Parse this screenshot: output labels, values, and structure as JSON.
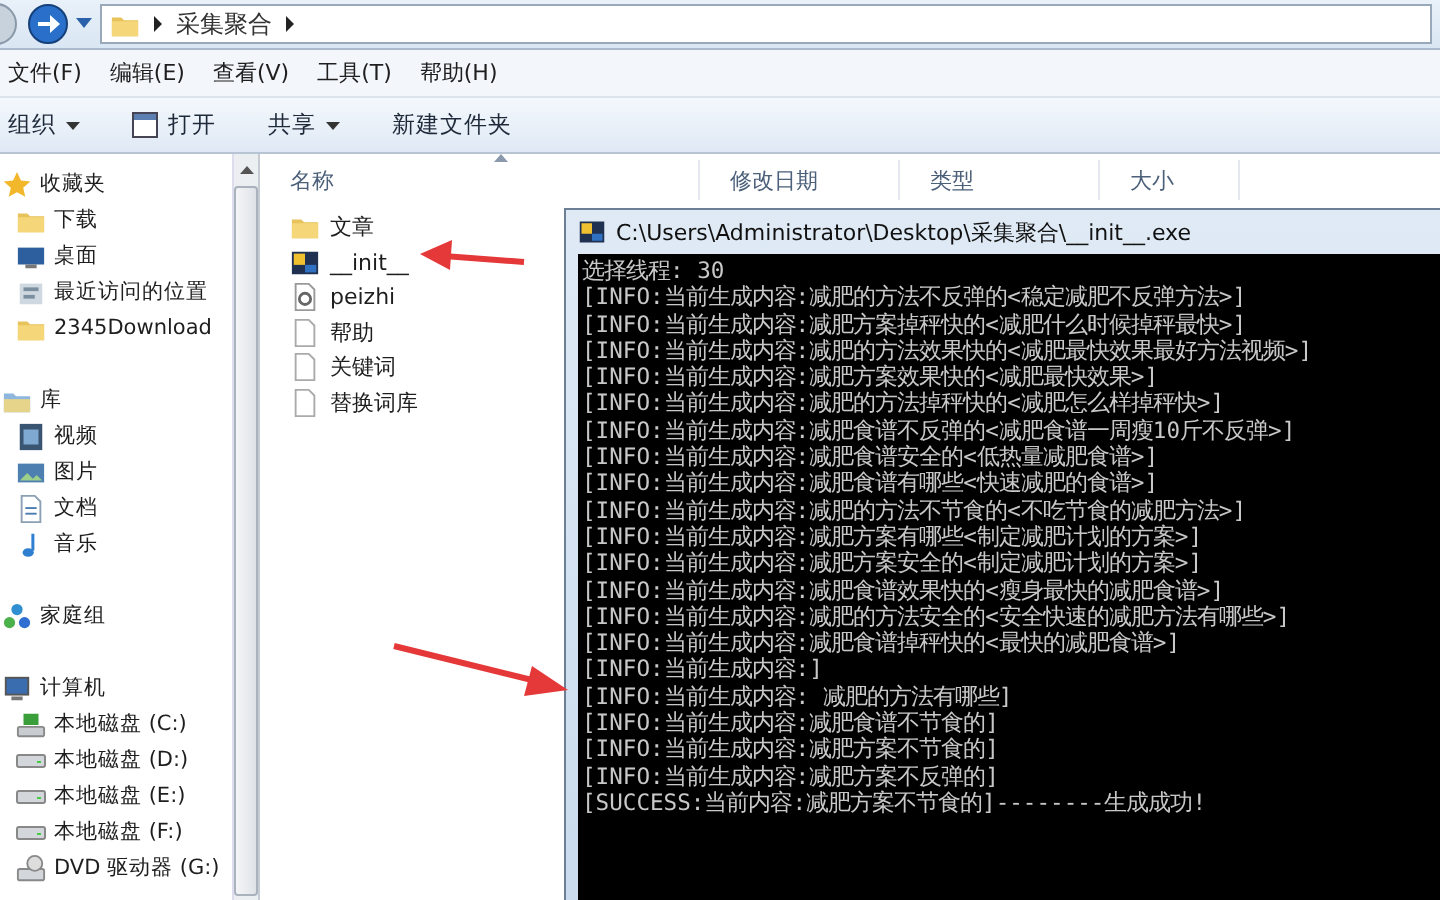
{
  "address_bar": {
    "path": [
      "采集聚合"
    ]
  },
  "menu_bar": [
    "文件(F)",
    "编辑(E)",
    "查看(V)",
    "工具(T)",
    "帮助(H)"
  ],
  "toolbar": [
    {
      "label": "组织",
      "kind": "menu"
    },
    {
      "label": "打开",
      "kind": "open"
    },
    {
      "label": "共享",
      "kind": "menu"
    },
    {
      "label": "新建文件夹",
      "kind": "plain"
    }
  ],
  "sidebar": {
    "groups": [
      {
        "label": "收藏夹",
        "kind": "star",
        "children": [
          {
            "label": "下载",
            "kind": "folder"
          },
          {
            "label": "桌面",
            "kind": "desktop"
          },
          {
            "label": "最近访问的位置",
            "kind": "recent"
          },
          {
            "label": "2345Download",
            "kind": "folder"
          }
        ]
      },
      {
        "label": "库",
        "kind": "library",
        "children": [
          {
            "label": "视频",
            "kind": "video"
          },
          {
            "label": "图片",
            "kind": "picture"
          },
          {
            "label": "文档",
            "kind": "document"
          },
          {
            "label": "音乐",
            "kind": "music"
          }
        ]
      },
      {
        "label": "家庭组",
        "kind": "homegroup"
      },
      {
        "label": "计算机",
        "kind": "computer",
        "children": [
          {
            "label": "本地磁盘 (C:)",
            "kind": "system-drive"
          },
          {
            "label": "本地磁盘 (D:)",
            "kind": "drive"
          },
          {
            "label": "本地磁盘 (E:)",
            "kind": "drive"
          },
          {
            "label": "本地磁盘 (F:)",
            "kind": "drive"
          },
          {
            "label": "DVD 驱动器 (G:)",
            "kind": "dvd"
          }
        ]
      }
    ]
  },
  "file_list": {
    "columns": [
      "名称",
      "修改日期",
      "类型",
      "大小"
    ],
    "items": [
      {
        "name": "文章",
        "kind": "folder"
      },
      {
        "name": "__init__",
        "kind": "exe"
      },
      {
        "name": "peizhi",
        "kind": "config"
      },
      {
        "name": "帮助",
        "kind": "file"
      },
      {
        "name": "关键词",
        "kind": "file"
      },
      {
        "name": "替换词库",
        "kind": "file"
      }
    ]
  },
  "console": {
    "title": "C:\\Users\\Administrator\\Desktop\\采集聚合\\__init__.exe",
    "lines": [
      "选择线程: 30",
      "[INFO:当前生成内容:减肥的方法不反弹的<稳定减肥不反弹方法>]",
      "[INFO:当前生成内容:减肥方案掉秤快的<减肥什么时候掉秤最快>]",
      "[INFO:当前生成内容:减肥的方法效果快的<减肥最快效果最好方法视频>]",
      "[INFO:当前生成内容:减肥方案效果快的<减肥最快效果>]",
      "[INFO:当前生成内容:减肥的方法掉秤快的<减肥怎么样掉秤快>]",
      "[INFO:当前生成内容:减肥食谱不反弹的<减肥食谱一周瘦10斤不反弹>]",
      "[INFO:当前生成内容:减肥食谱安全的<低热量减肥食谱>]",
      "[INFO:当前生成内容:减肥食谱有哪些<快速减肥的食谱>]",
      "[INFO:当前生成内容:减肥的方法不节食的<不吃节食的减肥方法>]",
      "[INFO:当前生成内容:减肥方案有哪些<制定减肥计划的方案>]",
      "[INFO:当前生成内容:减肥方案安全的<制定减肥计划的方案>]",
      "[INFO:当前生成内容:减肥食谱效果快的<瘦身最快的减肥食谱>]",
      "[INFO:当前生成内容:减肥的方法安全的<安全快速的减肥方法有哪些>]",
      "[INFO:当前生成内容:减肥食谱掉秤快的<最快的减肥食谱>]",
      "[INFO:当前生成内容:]",
      "[INFO:当前生成内容: 减肥的方法有哪些]",
      "[INFO:当前生成内容:减肥食谱不节食的]",
      "[INFO:当前生成内容:减肥方案不节食的]",
      "[INFO:当前生成内容:减肥方案不反弹的]",
      "[SUCCESS:当前内容:减肥方案不节食的]--------生成成功!"
    ]
  }
}
